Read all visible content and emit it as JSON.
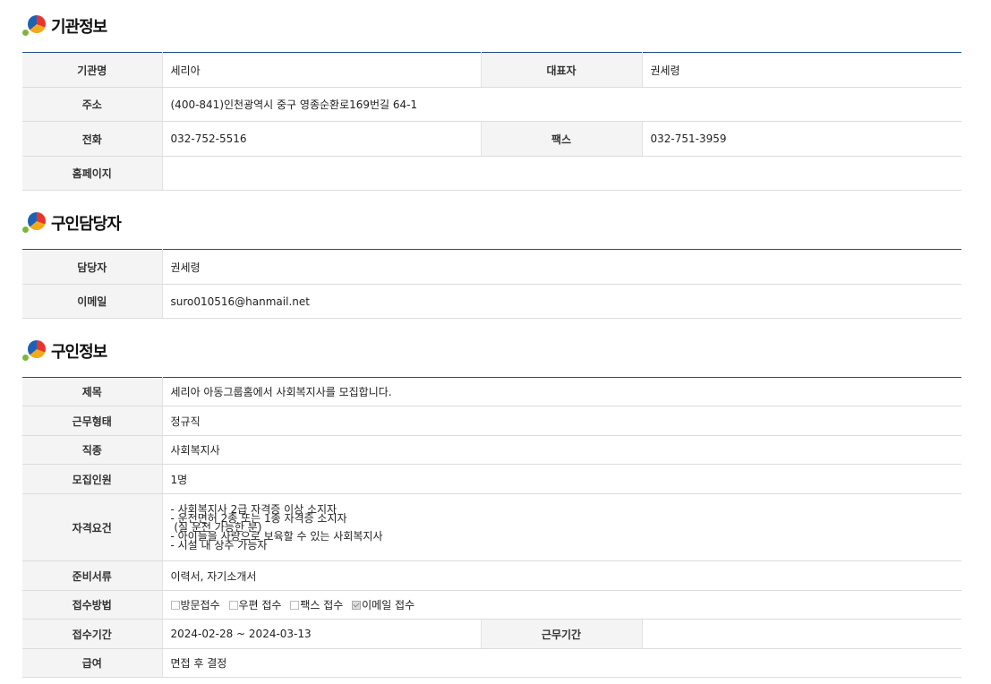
{
  "sections": {
    "agency": {
      "title": "기관정보",
      "rows": {
        "name_label": "기관명",
        "name_value": "세리아",
        "rep_label": "대표자",
        "rep_value": "권세령",
        "address_label": "주소",
        "address_value": "(400-841)인천광역시 중구 영종순환로169번길 64-1",
        "phone_label": "전화",
        "phone_value": "032-752-5516",
        "fax_label": "팩스",
        "fax_value": "032-751-3959",
        "homepage_label": "홈페이지",
        "homepage_value": ""
      }
    },
    "contact": {
      "title": "구인담당자",
      "rows": {
        "manager_label": "담당자",
        "manager_value": "권세령",
        "email_label": "이메일",
        "email_value": "suro010516@hanmail.net"
      }
    },
    "job": {
      "title": "구인정보",
      "rows": {
        "subject_label": "제목",
        "subject_value": "세리아 아동그룹홈에서 사회복지사를 모집합니다.",
        "worktype_label": "근무형태",
        "worktype_value": "정규직",
        "jobtype_label": "직종",
        "jobtype_value": "사회복지사",
        "headcount_label": "모집인원",
        "headcount_value": "1명",
        "qual_label": "자격요건",
        "qual_lines": [
          "- 사회복지사 2급 자격증 이상 소지자",
          "- 운전면허 2종 또는 1종 자격증 소지자",
          " (실 운전 가능한 분)",
          "- 아이들을 사랑으로 보육할 수 있는 사회복지사",
          "- 시설 내 상주 가능자"
        ],
        "docs_label": "준비서류",
        "docs_value": "이력서, 자기소개서",
        "method_label": "접수방법",
        "methods": [
          {
            "label": "방문접수",
            "checked": false
          },
          {
            "label": "우편 접수",
            "checked": false
          },
          {
            "label": "팩스 접수",
            "checked": false
          },
          {
            "label": "이메일 접수",
            "checked": true
          }
        ],
        "period_label": "접수기간",
        "period_value": "2024-02-28 ~ 2024-03-13",
        "workperiod_label": "근무기간",
        "workperiod_value": "",
        "salary_label": "급여",
        "salary_value": "면접 후 결정"
      }
    }
  },
  "colors": {
    "header_border": "#1e4a8c",
    "label_bg": "#f4f4f4",
    "row_border": "#dcdcdc"
  },
  "icons": {
    "section_logo": "colorful-ball-logo-icon"
  }
}
